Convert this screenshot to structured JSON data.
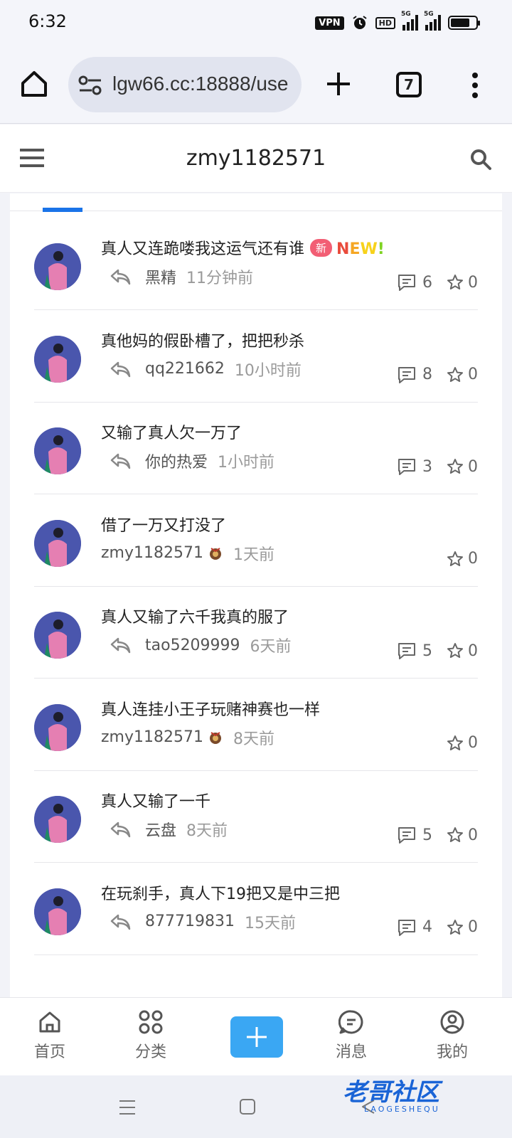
{
  "status_bar": {
    "time": "6:32",
    "vpn": "VPN",
    "hd": "HD",
    "signal_label": "5G",
    "icons": [
      "vpn-icon",
      "alarm-icon",
      "hd-icon",
      "signal-5g-icon",
      "signal-5g-icon",
      "battery-icon"
    ]
  },
  "browser": {
    "url": "lgw66.cc:18888/use",
    "tab_count": "7",
    "icons": [
      "home-icon",
      "site-settings-icon",
      "plus-icon",
      "tabs-icon",
      "more-vert-icon"
    ]
  },
  "header": {
    "title": "zmy1182571",
    "icons": [
      "menu-icon",
      "search-icon"
    ]
  },
  "posts": [
    {
      "title": "真人又连跪喽我这运气还有谁",
      "badge": "新",
      "tag": "NEW!",
      "user": "黑精",
      "time": "11分钟前",
      "comments": "6",
      "stars": "0",
      "reply": true
    },
    {
      "title": "真他妈的假卧槽了，把把秒杀",
      "user": "qq221662",
      "time": "10小时前",
      "comments": "8",
      "stars": "0",
      "reply": true
    },
    {
      "title": "又输了真人欠一万了",
      "user": "你的热爱",
      "time": "1小时前",
      "comments": "3",
      "stars": "0",
      "reply": true
    },
    {
      "title": "借了一万又打没了",
      "user": "zmy1182571",
      "time": "1天前",
      "stars": "0",
      "reply": false
    },
    {
      "title": "真人又输了六千我真的服了",
      "user": "tao5209999",
      "time": "6天前",
      "comments": "5",
      "stars": "0",
      "reply": true
    },
    {
      "title": "真人连挂小王子玩赌神赛也一样",
      "user": "zmy1182571",
      "time": "8天前",
      "stars": "0",
      "reply": false
    },
    {
      "title": "真人又输了一千",
      "user": "云盘",
      "time": "8天前",
      "comments": "5",
      "stars": "0",
      "reply": true
    },
    {
      "title": "在玩刹手，真人下19把又是中三把",
      "user": "877719831",
      "time": "15天前",
      "comments": "4",
      "stars": "0",
      "reply": true
    }
  ],
  "bottom_nav": {
    "home": "首页",
    "category": "分类",
    "messages": "消息",
    "mine": "我的",
    "icons": [
      "home-icon",
      "grid-icon",
      "add-icon",
      "chat-icon",
      "user-icon"
    ]
  },
  "watermark": {
    "text": "老哥社区",
    "sub": "LAOGESHEQU"
  },
  "colors": {
    "accent": "#1a73e8",
    "add_button": "#3aa7f3",
    "new_badge": "#f25e74",
    "avatar_bg": "#4a56ad",
    "watermark": "#1a64d6"
  }
}
